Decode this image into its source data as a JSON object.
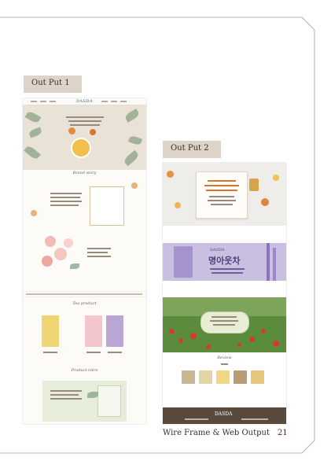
{
  "labels": {
    "output1": "Out Put 1",
    "output2": "Out Put 2"
  },
  "output1": {
    "logo": "DASDA",
    "section_heading_1": "Brand story",
    "section_heading_2": "Tea product",
    "section_heading_3": "Product intro"
  },
  "output2": {
    "logo": "DASDA",
    "banner_title": "명아웃차",
    "section_heading": "Review"
  },
  "caption": {
    "text": "Wire Frame & Web Output",
    "page": "21"
  },
  "colors": {
    "tag_bg": "#ddd3c8",
    "footer": "#5a4a3e",
    "lavender": "#c9bfe0",
    "field": "#5b8c3e"
  }
}
